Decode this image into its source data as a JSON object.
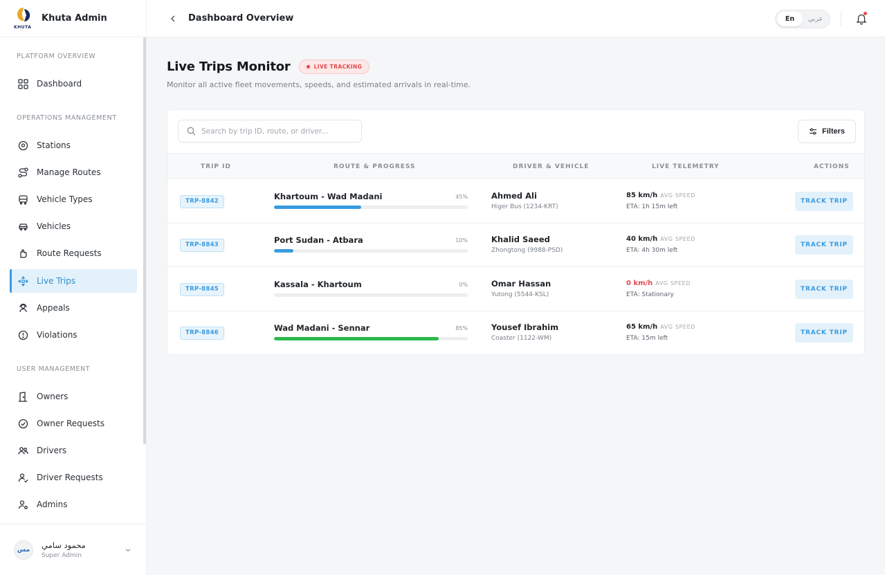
{
  "app": {
    "brand_name": "Khuta Admin",
    "logo_word": "KHUTA"
  },
  "sidebar": {
    "sections": [
      {
        "title": "PLATFORM OVERVIEW"
      },
      {
        "title": "OPERATIONS MANAGEMENT"
      },
      {
        "title": "USER MANAGEMENT"
      }
    ],
    "items": [
      {
        "label": "Dashboard",
        "icon": "grid-icon"
      },
      {
        "label": "Stations",
        "icon": "map-pin-icon"
      },
      {
        "label": "Manage Routes",
        "icon": "route-icon"
      },
      {
        "label": "Vehicle Types",
        "icon": "bus-icon"
      },
      {
        "label": "Vehicles",
        "icon": "car-icon"
      },
      {
        "label": "Route Requests",
        "icon": "hand-icon"
      },
      {
        "label": "Live Trips",
        "icon": "move-icon",
        "active": true
      },
      {
        "label": "Appeals",
        "icon": "users-headset-icon"
      },
      {
        "label": "Violations",
        "icon": "alert-circle-icon"
      },
      {
        "label": "Owners",
        "icon": "door-icon"
      },
      {
        "label": "Owner Requests",
        "icon": "check-circle-icon"
      },
      {
        "label": "Drivers",
        "icon": "users-icon"
      },
      {
        "label": "Driver Requests",
        "icon": "user-check-icon"
      },
      {
        "label": "Admins",
        "icon": "user-cog-icon"
      }
    ],
    "user": {
      "initials": "مس",
      "name": "محمود سامي",
      "role": "Super Admin"
    }
  },
  "header": {
    "title": "Dashboard Overview",
    "lang_en": "En",
    "lang_ar": "عربي",
    "active_lang": "En"
  },
  "main": {
    "title": "Live Trips Monitor",
    "badge": "LIVE TRACKING",
    "subtitle": "Monitor all active fleet movements, speeds, and estimated arrivals in real-time.",
    "search_placeholder": "Search by trip ID, route, or driver...",
    "filters_label": "Filters",
    "columns": [
      "TRIP ID",
      "ROUTE & PROGRESS",
      "DRIVER & VEHICLE",
      "LIVE TELEMETRY",
      "ACTIONS"
    ],
    "speed_label": "AVG SPEED",
    "action_label": "TRACK TRIP",
    "trips": [
      {
        "id": "TRP-8842",
        "route": "Khartoum - Wad Madani",
        "progress_pct": "45%",
        "progress": 0.45,
        "color": "#3a9be0",
        "driver": "Ahmed Ali",
        "vehicle": "Higer Bus (1234-KRT)",
        "speed": "85 km/h",
        "eta": "ETA: 1h 15m left",
        "stationary": false
      },
      {
        "id": "TRP-8843",
        "route": "Port Sudan - Atbara",
        "progress_pct": "10%",
        "progress": 0.1,
        "color": "#3a9be0",
        "driver": "Khalid Saeed",
        "vehicle": "Zhongtong (9988-PSD)",
        "speed": "40 km/h",
        "eta": "ETA: 4h 30m left",
        "stationary": false
      },
      {
        "id": "TRP-8845",
        "route": "Kassala - Khartoum",
        "progress_pct": "0%",
        "progress": 0.0,
        "color": "#3a9be0",
        "driver": "Omar Hassan",
        "vehicle": "Yutong (5544-KSL)",
        "speed": "0 km/h",
        "eta": "ETA: Stationary",
        "stationary": true
      },
      {
        "id": "TRP-8846",
        "route": "Wad Madani - Sennar",
        "progress_pct": "85%",
        "progress": 0.85,
        "color": "#2db84c",
        "driver": "Yousef Ibrahim",
        "vehicle": "Coaster (1122-WM)",
        "speed": "65 km/h",
        "eta": "ETA: 15m left",
        "stationary": false
      }
    ]
  }
}
